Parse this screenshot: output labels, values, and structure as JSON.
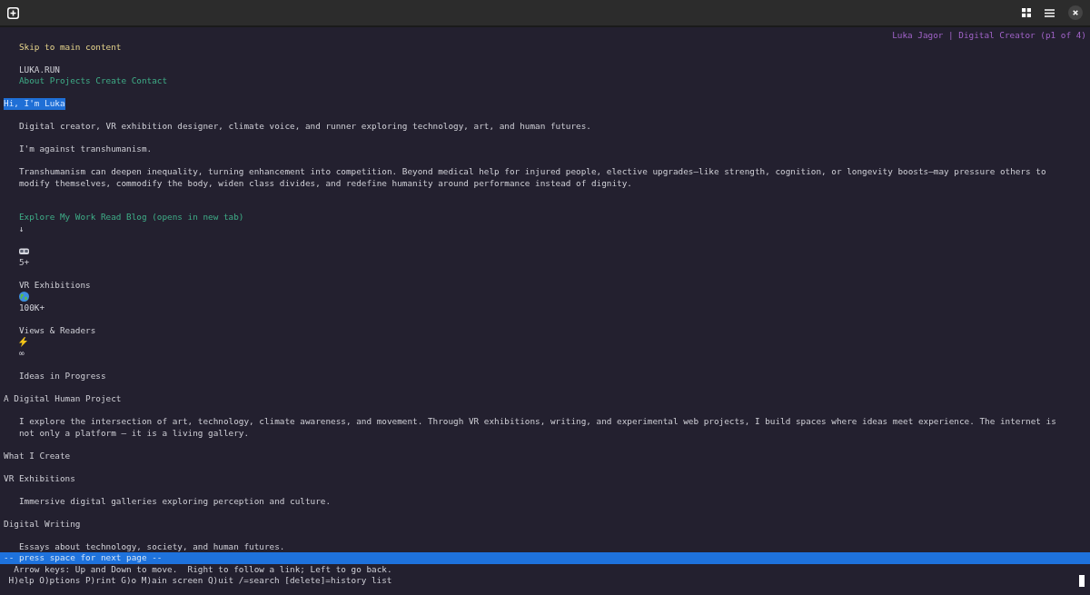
{
  "page_title": "Luka Jagor | Digital Creator (p1 of 4)",
  "lines": [
    {
      "kind": "link_row",
      "links": [
        {
          "text": "Skip to main content",
          "selected": true
        }
      ]
    },
    {
      "kind": "blank"
    },
    {
      "kind": "para",
      "text": "LUKA.RUN"
    },
    {
      "kind": "link_row",
      "links": [
        {
          "text": "About",
          "selected": false
        },
        {
          "text": "Projects",
          "selected": false
        },
        {
          "text": "Create",
          "selected": false
        },
        {
          "text": "Contact",
          "selected": false
        }
      ]
    },
    {
      "kind": "blank"
    },
    {
      "kind": "heading",
      "text": "Hi, I'm Luka",
      "highlighted": true
    },
    {
      "kind": "blank"
    },
    {
      "kind": "para",
      "text": "Digital creator, VR exhibition designer, climate voice, and runner exploring technology, art, and human futures."
    },
    {
      "kind": "blank"
    },
    {
      "kind": "para",
      "text": "I'm against transhumanism."
    },
    {
      "kind": "blank"
    },
    {
      "kind": "para",
      "text": "Transhumanism can deepen inequality, turning enhancement into competition. Beyond medical help for injured people, elective upgrades—like strength, cognition, or longevity boosts—may pressure others to"
    },
    {
      "kind": "para",
      "text": "modify themselves, commodify the body, widen class divides, and redefine humanity around performance instead of dignity."
    },
    {
      "kind": "blank"
    },
    {
      "kind": "blank"
    },
    {
      "kind": "link_row",
      "links": [
        {
          "text": "Explore My Work",
          "selected": false
        },
        {
          "text": "Read Blog (opens in new tab)",
          "selected": false
        }
      ]
    },
    {
      "kind": "para",
      "text": "↓"
    },
    {
      "kind": "blank"
    },
    {
      "kind": "emoji"
    },
    {
      "kind": "para",
      "text": "5+"
    },
    {
      "kind": "blank"
    },
    {
      "kind": "para",
      "text": "VR Exhibitions"
    },
    {
      "kind": "emoji"
    },
    {
      "kind": "para",
      "text": "100K+"
    },
    {
      "kind": "blank"
    },
    {
      "kind": "para",
      "text": "Views & Readers"
    },
    {
      "kind": "emoji"
    },
    {
      "kind": "para",
      "text": "∞"
    },
    {
      "kind": "blank"
    },
    {
      "kind": "para",
      "text": "Ideas in Progress"
    },
    {
      "kind": "blank"
    },
    {
      "kind": "heading",
      "text": "A Digital Human Project",
      "highlighted": false
    },
    {
      "kind": "blank"
    },
    {
      "kind": "para",
      "text": "I explore the intersection of art, technology, climate awareness, and movement. Through VR exhibitions, writing, and experimental web projects, I build spaces where ideas meet experience. The internet is"
    },
    {
      "kind": "para",
      "text": "not only a platform — it is a living gallery."
    },
    {
      "kind": "blank"
    },
    {
      "kind": "heading",
      "text": "What I Create",
      "highlighted": false
    },
    {
      "kind": "blank"
    },
    {
      "kind": "heading",
      "text": "VR Exhibitions",
      "highlighted": false
    },
    {
      "kind": "blank"
    },
    {
      "kind": "para",
      "text": "Immersive digital galleries exploring perception and culture."
    },
    {
      "kind": "blank"
    },
    {
      "kind": "heading",
      "text": "Digital Writing",
      "highlighted": false
    },
    {
      "kind": "blank"
    },
    {
      "kind": "para",
      "text": "Essays about technology, society, and human futures."
    }
  ],
  "prompt": "-- press space for next page --",
  "hint": "Arrow keys: Up and Down to move.  Right to follow a link; Left to go back.",
  "commands": "H)elp O)ptions P)rint G)o M)ain screen Q)uit /=search [delete]=history list"
}
